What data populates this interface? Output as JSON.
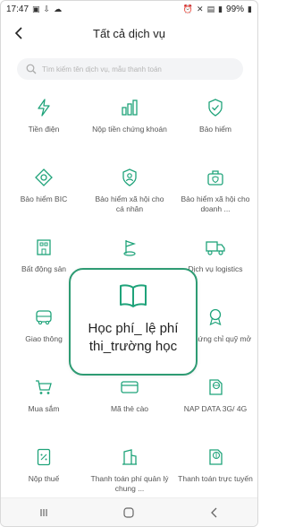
{
  "status": {
    "time": "17:47",
    "left_icons": [
      "image-icon",
      "download-icon",
      "cloud-icon"
    ],
    "right_text": "99%",
    "right_icons": [
      "alarm-icon",
      "mute-icon",
      "volte-icon",
      "signal-icon",
      "battery-icon"
    ]
  },
  "header": {
    "title": "Tất cả dịch vụ"
  },
  "search": {
    "placeholder": "Tìm kiếm tên dịch vụ, mẫu thanh toán"
  },
  "services": [
    {
      "label": "Tiền điện",
      "icon": "lightning-icon"
    },
    {
      "label": "Nộp tiền chứng khoán",
      "icon": "stock-chart-icon"
    },
    {
      "label": "Bảo hiểm",
      "icon": "shield-check-icon"
    },
    {
      "label": "Bảo hiểm BIC",
      "icon": "diamond-icon"
    },
    {
      "label": "Bảo hiểm xã hội cho cá nhân",
      "icon": "shield-person-icon"
    },
    {
      "label": "Bảo hiểm xã hội cho doanh ...",
      "icon": "bag-shield-icon"
    },
    {
      "label": "Bất động sản",
      "icon": "building-icon"
    },
    {
      "label": "",
      "icon": "flag-icon"
    },
    {
      "label": "Dịch vụ logistics",
      "icon": "truck-icon"
    },
    {
      "label": "Giao thông",
      "icon": "bus-icon"
    },
    {
      "label": "",
      "icon": ""
    },
    {
      "label": "ua chứng chỉ quỹ mở",
      "icon": "badge-icon"
    },
    {
      "label": "Mua sắm",
      "icon": "cart-icon"
    },
    {
      "label": "Mã thẻ cào",
      "icon": "card-icon"
    },
    {
      "label": "NAP DATA 3G/ 4G",
      "icon": "sim-globe-icon"
    },
    {
      "label": "Nộp thuế",
      "icon": "tax-doc-icon"
    },
    {
      "label": "Thanh toán phí quản lý chung ...",
      "icon": "bank-icon"
    },
    {
      "label": "Thanh toán trực tuyến",
      "icon": "globe-doc-icon"
    }
  ],
  "tooltip": {
    "label": "Học phí_ lệ phí thi_trường học",
    "icon": "book-icon"
  },
  "nav": {
    "recent_icon": "recents-icon",
    "home_icon": "home-icon",
    "back_icon": "back-icon"
  },
  "colors": {
    "accent": "#1fa37a",
    "tooltip_border": "#2e9b73"
  }
}
